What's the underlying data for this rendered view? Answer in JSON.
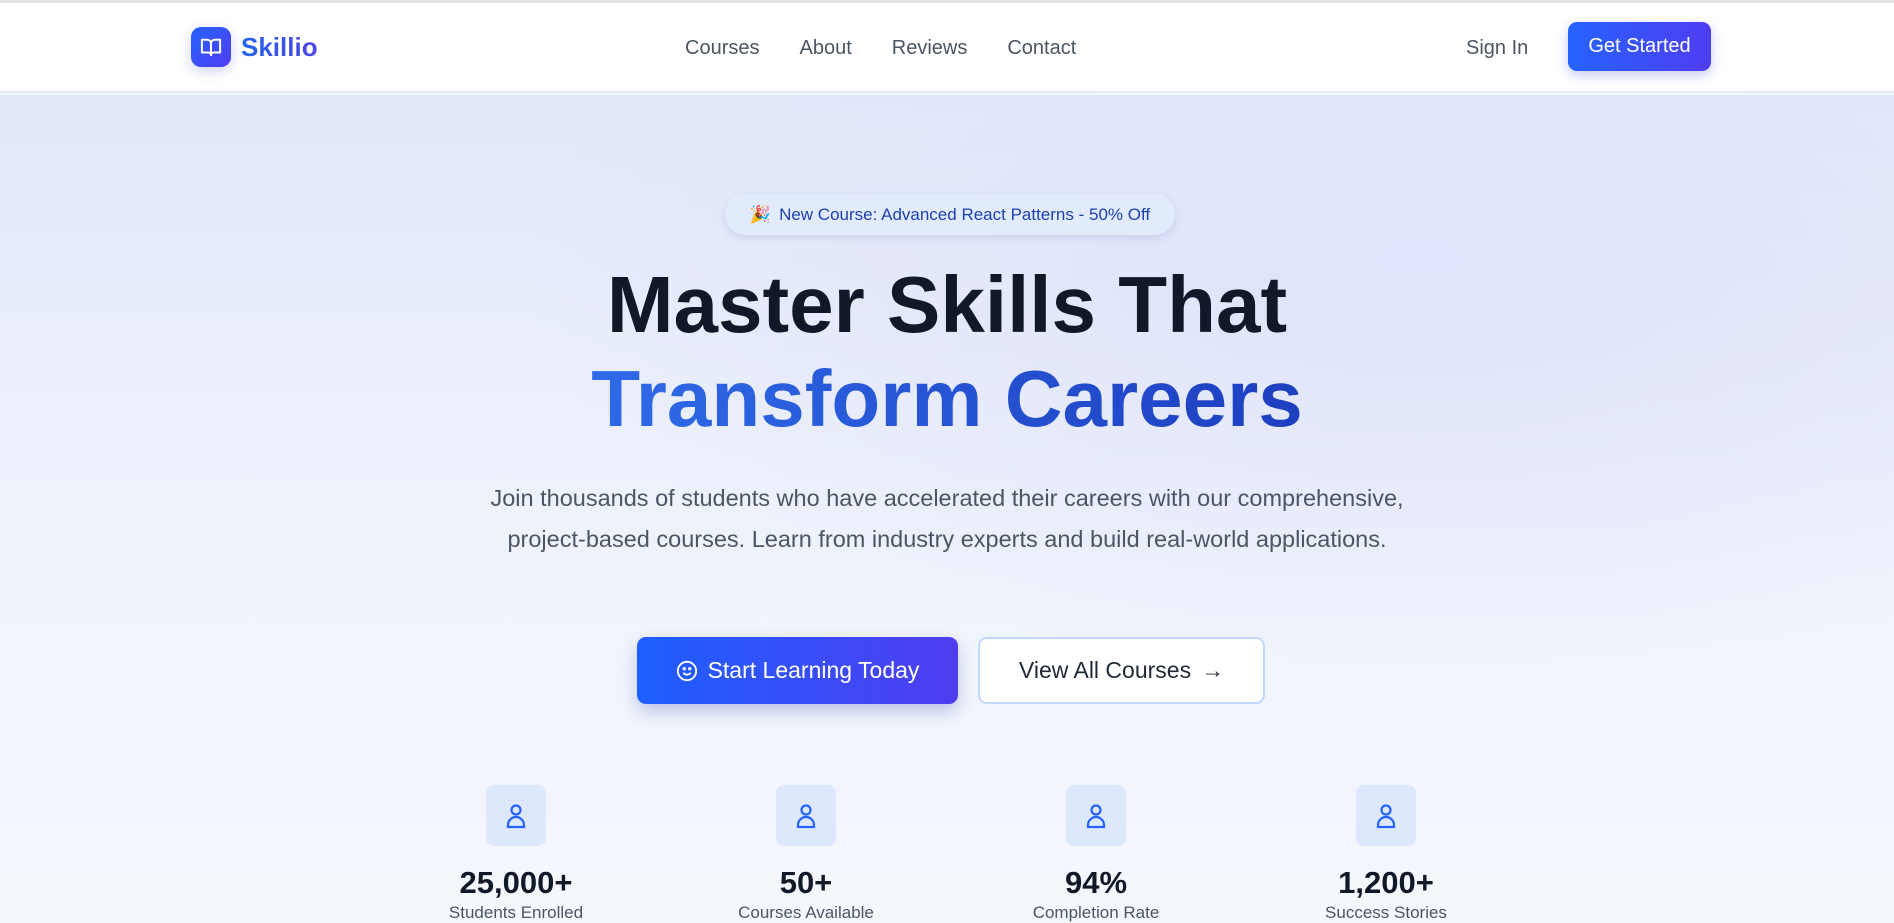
{
  "brand": {
    "name": "Skillio",
    "icon": "book-open-icon"
  },
  "nav": {
    "links": [
      "Courses",
      "About",
      "Reviews",
      "Contact"
    ],
    "sign_in": "Sign In",
    "get_started": "Get Started"
  },
  "hero": {
    "badge_icon": "🎉",
    "badge": "New Course: Advanced React Patterns - 50% Off",
    "title_line1": "Master Skills That",
    "title_line2": "Transform Careers",
    "description": "Join thousands of students who have accelerated their careers with our comprehensive, project-based courses. Learn from industry experts and build real-world applications.",
    "primary_button": "Start Learning Today",
    "secondary_button": "View All Courses",
    "secondary_arrow": "→"
  },
  "stats": [
    {
      "value": "25,000+",
      "label": "Students Enrolled",
      "icon": "user-icon"
    },
    {
      "value": "50+",
      "label": "Courses Available",
      "icon": "user-icon"
    },
    {
      "value": "94%",
      "label": "Completion Rate",
      "icon": "user-icon"
    },
    {
      "value": "1,200+",
      "label": "Success Stories",
      "icon": "user-icon"
    }
  ],
  "colors": {
    "accent": "#2563ff",
    "accent2": "#4f3df0",
    "text": "#111827"
  }
}
